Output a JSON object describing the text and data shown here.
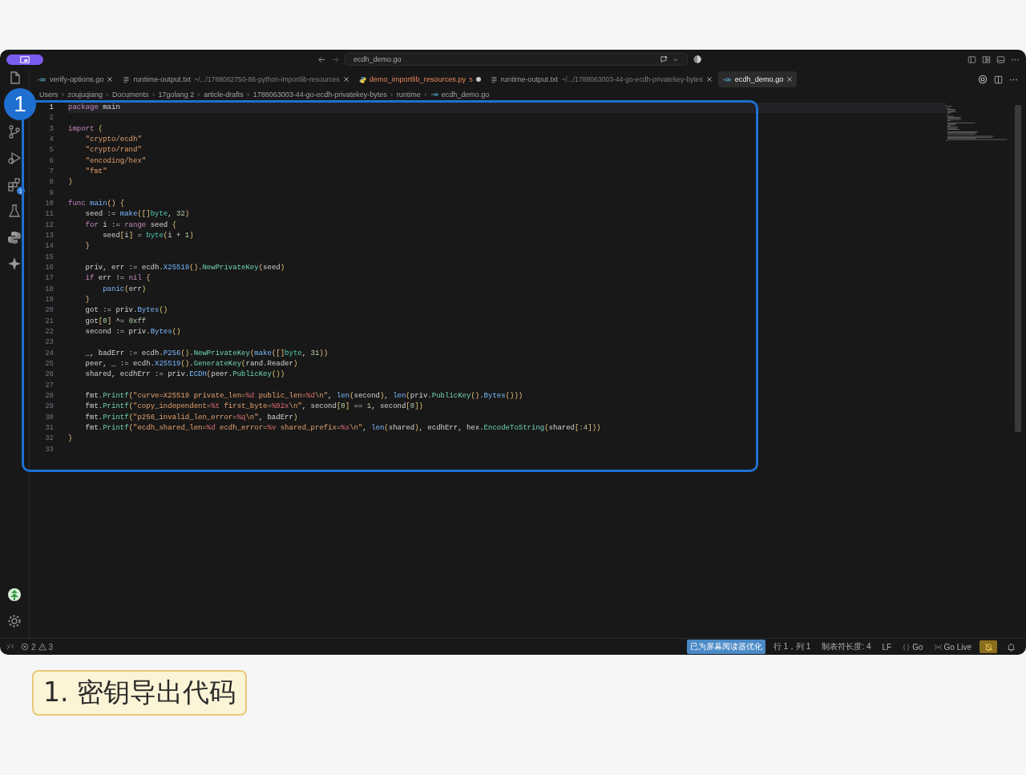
{
  "title_bar": {
    "command_center": "ecdh_demo.go"
  },
  "activity_bar": {
    "top": [
      {
        "kind": "explorer"
      },
      {
        "kind": "source-control"
      },
      {
        "kind": "run-debug"
      },
      {
        "kind": "extensions",
        "badge": "1"
      },
      {
        "kind": "testing"
      },
      {
        "kind": "python"
      },
      {
        "kind": "sparkle"
      }
    ],
    "bottom": [
      {
        "kind": "account"
      },
      {
        "kind": "settings"
      }
    ]
  },
  "tabs": [
    {
      "kind": "go",
      "label": "verify-options.go",
      "selected": false,
      "modified": false
    },
    {
      "kind": "text",
      "label": "runtime-output.txt",
      "description": "~/.../1788062750-86-python-importlib-resources",
      "selected": false,
      "modified": false
    },
    {
      "kind": "python",
      "label": "demo_importlib_resources.py",
      "problems": "5",
      "selected": false,
      "modified": true
    },
    {
      "kind": "text",
      "label": "runtime-output.txt",
      "description": "~/.../1788063003-44-go-ecdh-privatekey-bytes",
      "selected": false,
      "modified": false
    },
    {
      "kind": "go",
      "label": "ecdh_demo.go",
      "selected": true,
      "modified": false
    }
  ],
  "breadcrumb": [
    "Users",
    "zoujuqiang",
    "Documents",
    "17golang 2",
    "article-drafts",
    "1788063003-44-go-ecdh-privatekey-bytes",
    "runtime",
    "ecdh_demo.go"
  ],
  "editor": {
    "lines": [
      {
        "number": "1",
        "current": true,
        "tokens": [
          {
            "text": "package",
            "kind": "k"
          },
          {
            "text": " main",
            "kind": "x"
          }
        ]
      },
      {
        "number": "2",
        "current": false
      },
      {
        "number": "3",
        "current": false,
        "tokens": [
          {
            "text": "import",
            "kind": "k"
          },
          {
            "text": " (",
            "kind": "b"
          }
        ]
      },
      {
        "number": "4",
        "current": false,
        "tokens": [
          {
            "text": "    \"crypto/ecdh\"",
            "kind": "s"
          }
        ]
      },
      {
        "number": "5",
        "current": false,
        "tokens": [
          {
            "text": "    \"crypto/rand\"",
            "kind": "s"
          }
        ]
      },
      {
        "number": "6",
        "current": false,
        "tokens": [
          {
            "text": "    \"encoding/hex\"",
            "kind": "s"
          }
        ]
      },
      {
        "number": "7",
        "current": false,
        "tokens": [
          {
            "text": "    \"fmt\"",
            "kind": "s"
          }
        ]
      },
      {
        "number": "8",
        "current": false,
        "tokens": [
          {
            "text": ")",
            "kind": "b"
          }
        ]
      },
      {
        "number": "9",
        "current": false
      },
      {
        "number": "10",
        "current": false,
        "tokens": [
          {
            "text": "func",
            "kind": "k"
          },
          {
            "text": " main",
            "kind": "f"
          },
          {
            "text": "() {",
            "kind": "b"
          }
        ]
      },
      {
        "number": "11",
        "current": false,
        "tokens": [
          {
            "text": "    seed := ",
            "kind": "x"
          },
          {
            "text": "make",
            "kind": "f"
          },
          {
            "text": "([]",
            "kind": "b"
          },
          {
            "text": "byte",
            "kind": "t"
          },
          {
            "text": ", ",
            "kind": "x"
          },
          {
            "text": "32",
            "kind": "n"
          },
          {
            "text": ")",
            "kind": "b"
          }
        ]
      },
      {
        "number": "12",
        "current": false,
        "tokens": [
          {
            "text": "    for",
            "kind": "k"
          },
          {
            "text": " i := ",
            "kind": "x"
          },
          {
            "text": "range",
            "kind": "k"
          },
          {
            "text": " seed ",
            "kind": "x"
          },
          {
            "text": "{",
            "kind": "b"
          }
        ]
      },
      {
        "number": "13",
        "current": false,
        "tokens": [
          {
            "text": "        seed",
            "kind": "x"
          },
          {
            "text": "[",
            "kind": "b"
          },
          {
            "text": "i",
            "kind": "x"
          },
          {
            "text": "]",
            "kind": "b"
          },
          {
            "text": " = ",
            "kind": "x"
          },
          {
            "text": "byte",
            "kind": "t"
          },
          {
            "text": "(",
            "kind": "b"
          },
          {
            "text": "i + ",
            "kind": "x"
          },
          {
            "text": "1",
            "kind": "n"
          },
          {
            "text": ")",
            "kind": "b"
          }
        ]
      },
      {
        "number": "14",
        "current": false,
        "tokens": [
          {
            "text": "    }",
            "kind": "b"
          }
        ]
      },
      {
        "number": "15",
        "current": false
      },
      {
        "number": "16",
        "current": false,
        "tokens": [
          {
            "text": "    priv, err := ecdh.",
            "kind": "x"
          },
          {
            "text": "X25519",
            "kind": "f"
          },
          {
            "text": "()",
            "kind": "b"
          },
          {
            "text": ".",
            "kind": "x"
          },
          {
            "text": "NewPrivateKey",
            "kind": "m"
          },
          {
            "text": "(",
            "kind": "b"
          },
          {
            "text": "seed",
            "kind": "x"
          },
          {
            "text": ")",
            "kind": "b"
          }
        ]
      },
      {
        "number": "17",
        "current": false,
        "tokens": [
          {
            "text": "    if",
            "kind": "k"
          },
          {
            "text": " err != ",
            "kind": "x"
          },
          {
            "text": "nil",
            "kind": "k"
          },
          {
            "text": " {",
            "kind": "b"
          }
        ]
      },
      {
        "number": "18",
        "current": false,
        "tokens": [
          {
            "text": "        panic",
            "kind": "f"
          },
          {
            "text": "(",
            "kind": "b"
          },
          {
            "text": "err",
            "kind": "x"
          },
          {
            "text": ")",
            "kind": "b"
          }
        ]
      },
      {
        "number": "19",
        "current": false,
        "tokens": [
          {
            "text": "    }",
            "kind": "b"
          }
        ]
      },
      {
        "number": "20",
        "current": false,
        "tokens": [
          {
            "text": "    got := priv.",
            "kind": "x"
          },
          {
            "text": "Bytes",
            "kind": "f"
          },
          {
            "text": "()",
            "kind": "b"
          }
        ]
      },
      {
        "number": "21",
        "current": false,
        "tokens": [
          {
            "text": "    got",
            "kind": "x"
          },
          {
            "text": "[",
            "kind": "b"
          },
          {
            "text": "0",
            "kind": "n"
          },
          {
            "text": "]",
            "kind": "b"
          },
          {
            "text": " ^= ",
            "kind": "x"
          },
          {
            "text": "0xff",
            "kind": "n"
          }
        ]
      },
      {
        "number": "22",
        "current": false,
        "tokens": [
          {
            "text": "    second := priv.",
            "kind": "x"
          },
          {
            "text": "Bytes",
            "kind": "f"
          },
          {
            "text": "()",
            "kind": "b"
          }
        ]
      },
      {
        "number": "23",
        "current": false
      },
      {
        "number": "24",
        "current": false,
        "tokens": [
          {
            "text": "    _, badErr := ecdh.",
            "kind": "x"
          },
          {
            "text": "P256",
            "kind": "f"
          },
          {
            "text": "()",
            "kind": "b"
          },
          {
            "text": ".",
            "kind": "x"
          },
          {
            "text": "NewPrivateKey",
            "kind": "m"
          },
          {
            "text": "(",
            "kind": "b"
          },
          {
            "text": "make",
            "kind": "f"
          },
          {
            "text": "([]",
            "kind": "b"
          },
          {
            "text": "byte",
            "kind": "t"
          },
          {
            "text": ", ",
            "kind": "x"
          },
          {
            "text": "31",
            "kind": "n"
          },
          {
            "text": "))",
            "kind": "b"
          }
        ]
      },
      {
        "number": "25",
        "current": false,
        "tokens": [
          {
            "text": "    peer, _ := ecdh.",
            "kind": "x"
          },
          {
            "text": "X25519",
            "kind": "f"
          },
          {
            "text": "()",
            "kind": "b"
          },
          {
            "text": ".",
            "kind": "x"
          },
          {
            "text": "GenerateKey",
            "kind": "m"
          },
          {
            "text": "(",
            "kind": "b"
          },
          {
            "text": "rand.Reader",
            "kind": "x"
          },
          {
            "text": ")",
            "kind": "b"
          }
        ]
      },
      {
        "number": "26",
        "current": false,
        "tokens": [
          {
            "text": "    shared, ecdhErr := priv.",
            "kind": "x"
          },
          {
            "text": "ECDH",
            "kind": "f"
          },
          {
            "text": "(",
            "kind": "b"
          },
          {
            "text": "peer.",
            "kind": "x"
          },
          {
            "text": "PublicKey",
            "kind": "m"
          },
          {
            "text": "())",
            "kind": "b"
          }
        ]
      },
      {
        "number": "27",
        "current": false
      },
      {
        "number": "28",
        "current": false,
        "tokens": [
          {
            "text": "    fmt.",
            "kind": "x"
          },
          {
            "text": "Printf",
            "kind": "m"
          },
          {
            "text": "(",
            "kind": "b"
          },
          {
            "text": "\"curve=X25519 private_len=",
            "kind": "s"
          },
          {
            "text": "%d",
            "kind": "e"
          },
          {
            "text": " public_len=",
            "kind": "s"
          },
          {
            "text": "%d",
            "kind": "e"
          },
          {
            "text": "\\n\"",
            "kind": "s"
          },
          {
            "text": ", ",
            "kind": "x"
          },
          {
            "text": "len",
            "kind": "f"
          },
          {
            "text": "(",
            "kind": "b"
          },
          {
            "text": "second",
            "kind": "x"
          },
          {
            "text": ")",
            "kind": "b"
          },
          {
            "text": ", ",
            "kind": "x"
          },
          {
            "text": "len",
            "kind": "f"
          },
          {
            "text": "(",
            "kind": "b"
          },
          {
            "text": "priv.",
            "kind": "x"
          },
          {
            "text": "PublicKey",
            "kind": "m"
          },
          {
            "text": "()",
            "kind": "b"
          },
          {
            "text": ".",
            "kind": "x"
          },
          {
            "text": "Bytes",
            "kind": "f"
          },
          {
            "text": "()))",
            "kind": "b"
          }
        ]
      },
      {
        "number": "29",
        "current": false,
        "tokens": [
          {
            "text": "    fmt.",
            "kind": "x"
          },
          {
            "text": "Printf",
            "kind": "m"
          },
          {
            "text": "(",
            "kind": "b"
          },
          {
            "text": "\"copy_independent=",
            "kind": "s"
          },
          {
            "text": "%t",
            "kind": "e"
          },
          {
            "text": " first_byte=",
            "kind": "s"
          },
          {
            "text": "%02x",
            "kind": "e"
          },
          {
            "text": "\\n\"",
            "kind": "s"
          },
          {
            "text": ", second",
            "kind": "x"
          },
          {
            "text": "[",
            "kind": "b"
          },
          {
            "text": "0",
            "kind": "n"
          },
          {
            "text": "]",
            "kind": "b"
          },
          {
            "text": " == ",
            "kind": "x"
          },
          {
            "text": "1",
            "kind": "n"
          },
          {
            "text": ", second",
            "kind": "x"
          },
          {
            "text": "[",
            "kind": "b"
          },
          {
            "text": "0",
            "kind": "n"
          },
          {
            "text": "])",
            "kind": "b"
          }
        ]
      },
      {
        "number": "30",
        "current": false,
        "tokens": [
          {
            "text": "    fmt.",
            "kind": "x"
          },
          {
            "text": "Printf",
            "kind": "m"
          },
          {
            "text": "(",
            "kind": "b"
          },
          {
            "text": "\"p256_invalid_len_error=",
            "kind": "s"
          },
          {
            "text": "%q",
            "kind": "e"
          },
          {
            "text": "\\n\"",
            "kind": "s"
          },
          {
            "text": ", badErr",
            "kind": "x"
          },
          {
            "text": ")",
            "kind": "b"
          }
        ]
      },
      {
        "number": "31",
        "current": false,
        "tokens": [
          {
            "text": "    fmt.",
            "kind": "x"
          },
          {
            "text": "Printf",
            "kind": "m"
          },
          {
            "text": "(",
            "kind": "b"
          },
          {
            "text": "\"ecdh_shared_len=",
            "kind": "s"
          },
          {
            "text": "%d",
            "kind": "e"
          },
          {
            "text": " ecdh_error=",
            "kind": "s"
          },
          {
            "text": "%v",
            "kind": "e"
          },
          {
            "text": " shared_prefix=",
            "kind": "s"
          },
          {
            "text": "%s",
            "kind": "e"
          },
          {
            "text": "\\n\"",
            "kind": "s"
          },
          {
            "text": ", ",
            "kind": "x"
          },
          {
            "text": "len",
            "kind": "f"
          },
          {
            "text": "(",
            "kind": "b"
          },
          {
            "text": "shared",
            "kind": "x"
          },
          {
            "text": ")",
            "kind": "b"
          },
          {
            "text": ", ecdhErr, hex.",
            "kind": "x"
          },
          {
            "text": "EncodeToString",
            "kind": "m"
          },
          {
            "text": "(",
            "kind": "b"
          },
          {
            "text": "shared",
            "kind": "x"
          },
          {
            "text": "[",
            "kind": "b"
          },
          {
            "text": ":4",
            "kind": "n"
          },
          {
            "text": "]))",
            "kind": "b"
          }
        ]
      },
      {
        "number": "32",
        "current": false,
        "tokens": [
          {
            "text": "}",
            "kind": "b"
          }
        ]
      },
      {
        "number": "33",
        "current": false
      }
    ]
  },
  "status_bar": {
    "errors": "2",
    "warnings": "3",
    "right_items": [
      {
        "text": "已为屏幕阅读器优化",
        "highlighted": true
      },
      {
        "text": "行 1，列 1",
        "highlighted": false
      },
      {
        "text": "制表符长度: 4",
        "highlighted": false
      },
      {
        "text": "LF",
        "highlighted": false
      },
      {
        "kind": "braces",
        "text": "Go",
        "highlighted": false
      },
      {
        "kind": "broadcast",
        "text": "Go Live",
        "highlighted": false
      }
    ],
    "right_buttons": [
      {
        "kind": "bell-slash",
        "highlighted": true
      },
      {
        "kind": "bell",
        "highlighted": false
      }
    ]
  },
  "annotation": {
    "number": "1"
  },
  "caption": "1. 密钥导出代码"
}
